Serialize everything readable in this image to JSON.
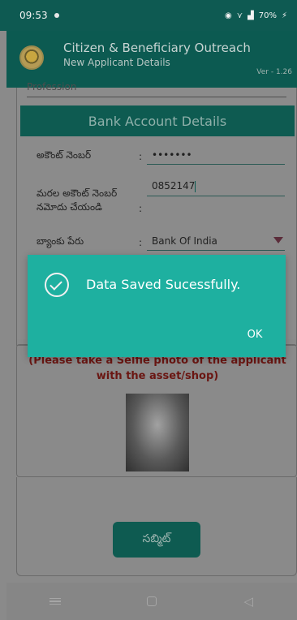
{
  "status_bar": {
    "time": "09:53",
    "battery": "70%"
  },
  "app": {
    "title": "Citizen & Beneficiary Outreach",
    "subtitle": "New Applicant Details",
    "version": "Ver - 1.26"
  },
  "form": {
    "profession_label": "Profession",
    "section_title": "Bank Account Details",
    "fields": [
      {
        "label": "అకౌంట్ నెంబర్",
        "value": "•••••••"
      },
      {
        "label": "మరల అకౌంట్ నెంబర్ నమోదు చేయండి",
        "value": "0852147"
      },
      {
        "label": "బ్యాంకు పేరు",
        "value": "Bank Of India"
      }
    ]
  },
  "photo": {
    "note": "(Please take a Selfie photo of the applicant with the asset/shop)"
  },
  "submit_label": "సబ్మిట్",
  "dialog": {
    "message": "Data Saved Sucessfully.",
    "ok_label": "OK"
  },
  "colors": {
    "primary": "#0e5b51",
    "dialog": "#1eb0a0"
  },
  "icons": [
    "location-icon",
    "wifi-icon",
    "signal-icon",
    "battery-icon",
    "check-circle-icon",
    "dropdown-arrow-icon",
    "menu-icon",
    "home-icon",
    "back-icon"
  ]
}
